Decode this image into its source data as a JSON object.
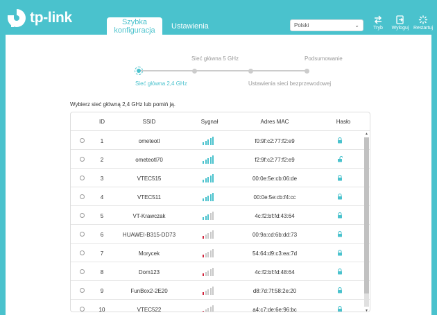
{
  "brand": {
    "name": "tp-link"
  },
  "header": {
    "tab_active_line1": "Szybka",
    "tab_active_line2": "konfiguracja",
    "tab_settings": "Ustawienia",
    "language": "Polski",
    "btn_mode": "Tryb",
    "btn_logout": "Wyloguj",
    "btn_restart": "Restartuj"
  },
  "steps": {
    "step1": "Sieć główna 2,4 GHz",
    "step2": "Sieć główna 5 GHz",
    "step3": "Ustawienia sieci bezprzewodowej",
    "step4": "Podsumowanie"
  },
  "prompt": "Wybierz sieć główną 2,4 GHz lub pomiń ją.",
  "table": {
    "headers": {
      "id": "ID",
      "ssid": "SSID",
      "signal": "Sygnał",
      "mac": "Adres MAC",
      "password": "Hasło"
    },
    "rows": [
      {
        "id": "1",
        "ssid": "ometeotl",
        "mac": "f0:9f:c2:77:f2:e9",
        "signal": 5,
        "locked": true
      },
      {
        "id": "2",
        "ssid": "ometeotl70",
        "mac": "f2:9f:c2:77:f2:e9",
        "signal": 5,
        "locked": false
      },
      {
        "id": "3",
        "ssid": "VTEC515",
        "mac": "00:0e:5e:cb:06:de",
        "signal": 5,
        "locked": true
      },
      {
        "id": "4",
        "ssid": "VTEC511",
        "mac": "00:0e:5e:cb:f4:cc",
        "signal": 5,
        "locked": true
      },
      {
        "id": "5",
        "ssid": "VT-Krawczak",
        "mac": "4c:f2:bf:fd:43:64",
        "signal": 3,
        "locked": true
      },
      {
        "id": "6",
        "ssid": "HUAWEI-B315-DD73",
        "mac": "00:9a:cd:6b:dd:73",
        "signal": 1,
        "locked": true
      },
      {
        "id": "7",
        "ssid": "Morycek",
        "mac": "54:64:d9:c3:ea:7d",
        "signal": 1,
        "locked": true
      },
      {
        "id": "8",
        "ssid": "Dom123",
        "mac": "4c:f2:bf:fd:48:64",
        "signal": 1,
        "locked": true
      },
      {
        "id": "9",
        "ssid": "FunBox2-2E20",
        "mac": "d8:7d:7f:58:2e:20",
        "signal": 1,
        "locked": true
      },
      {
        "id": "10",
        "ssid": "VTEC522",
        "mac": "a4:c7:de:6e:96:bc",
        "signal": 1,
        "locked": true
      }
    ]
  },
  "colors": {
    "accent": "#4ac2cd",
    "signal_good": "#4ac2cd",
    "signal_weak": "#d2233c",
    "signal_off": "#c8c8c8"
  },
  "icons": {
    "mode": "swap-icon",
    "logout": "logout-icon",
    "restart": "restart-icon",
    "lock": "lock-icon",
    "unlock": "unlock-icon"
  }
}
